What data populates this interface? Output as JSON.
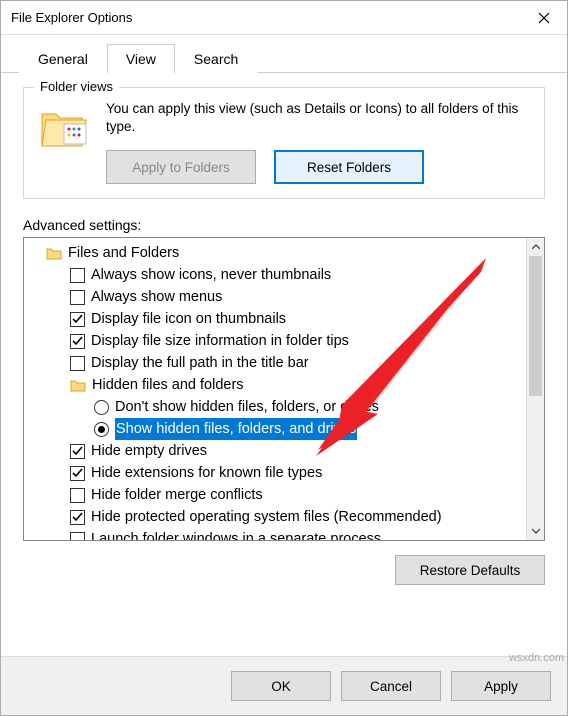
{
  "window": {
    "title": "File Explorer Options"
  },
  "tabs": {
    "general": "General",
    "view": "View",
    "search": "Search",
    "active": "view"
  },
  "folderViews": {
    "groupTitle": "Folder views",
    "desc": "You can apply this view (such as Details or Icons) to all folders of this type.",
    "applyBtn": "Apply to Folders",
    "resetBtn": "Reset Folders"
  },
  "advanced": {
    "label": "Advanced settings:",
    "filesFolders": "Files and Folders",
    "items": [
      {
        "type": "checkbox",
        "checked": false,
        "label": "Always show icons, never thumbnails"
      },
      {
        "type": "checkbox",
        "checked": false,
        "label": "Always show menus"
      },
      {
        "type": "checkbox",
        "checked": true,
        "label": "Display file icon on thumbnails"
      },
      {
        "type": "checkbox",
        "checked": true,
        "label": "Display file size information in folder tips"
      },
      {
        "type": "checkbox",
        "checked": false,
        "label": "Display the full path in the title bar"
      }
    ],
    "hiddenGroup": "Hidden files and folders",
    "radios": [
      {
        "selected": false,
        "label": "Don't show hidden files, folders, or drives"
      },
      {
        "selected": true,
        "label": "Show hidden files, folders, and drives",
        "highlighted": true
      }
    ],
    "items2": [
      {
        "type": "checkbox",
        "checked": true,
        "label": "Hide empty drives"
      },
      {
        "type": "checkbox",
        "checked": true,
        "label": "Hide extensions for known file types"
      },
      {
        "type": "checkbox",
        "checked": false,
        "label": "Hide folder merge conflicts"
      },
      {
        "type": "checkbox",
        "checked": true,
        "label": "Hide protected operating system files (Recommended)"
      },
      {
        "type": "checkbox",
        "checked": false,
        "label": "Launch folder windows in a separate process"
      }
    ]
  },
  "restoreBtn": "Restore Defaults",
  "buttons": {
    "ok": "OK",
    "cancel": "Cancel",
    "apply": "Apply"
  },
  "watermark": "wsxdn.com"
}
